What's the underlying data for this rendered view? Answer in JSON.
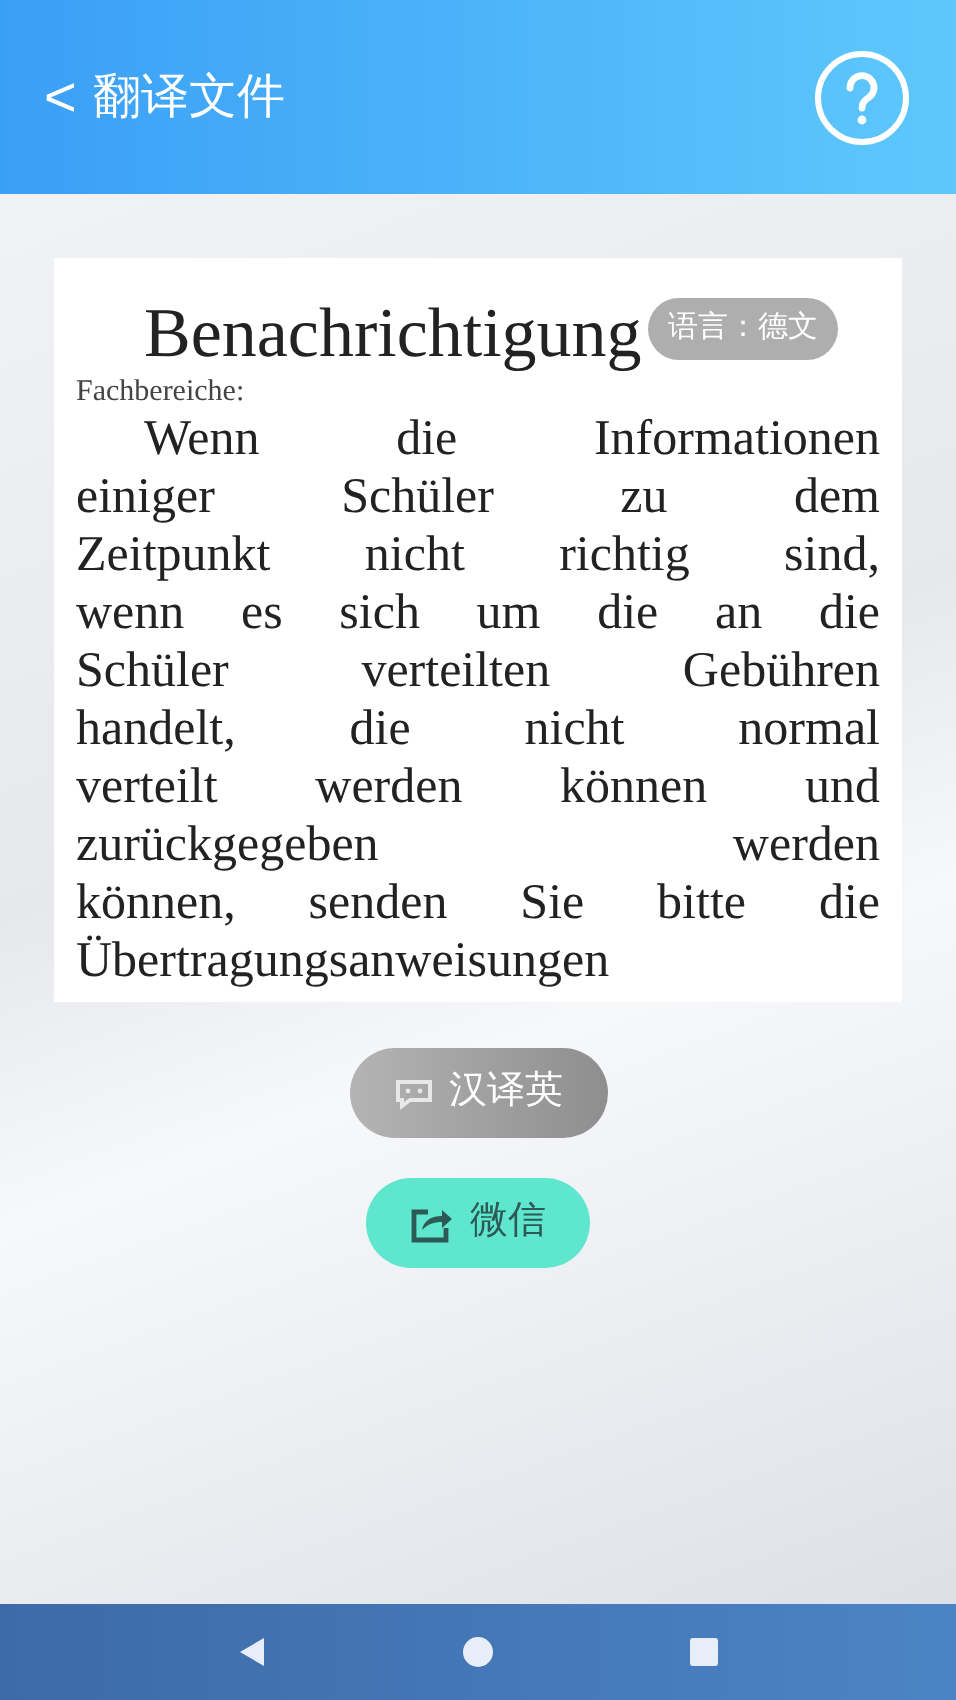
{
  "header": {
    "back": "<",
    "title": "翻译文件"
  },
  "document": {
    "title": "Benachrichtigung",
    "subtitle": "Fachbereiche:",
    "lines": [
      "Wenn die Informationen",
      "einiger Schüler zu dem",
      "Zeitpunkt nicht richtig sind,",
      "wenn es sich um die an die",
      "Schüler verteilten Gebühren",
      "handelt, die nicht normal",
      "verteilt werden können und",
      "zurückgegeben werden",
      "können, senden Sie bitte die",
      "Übertragungsanweisungen"
    ]
  },
  "language_badge": "语言：德文",
  "buttons": [
    {
      "kind": "translate",
      "label": "汉译英",
      "disabled": true
    },
    {
      "kind": "share",
      "label": "微信",
      "disabled": false
    }
  ]
}
